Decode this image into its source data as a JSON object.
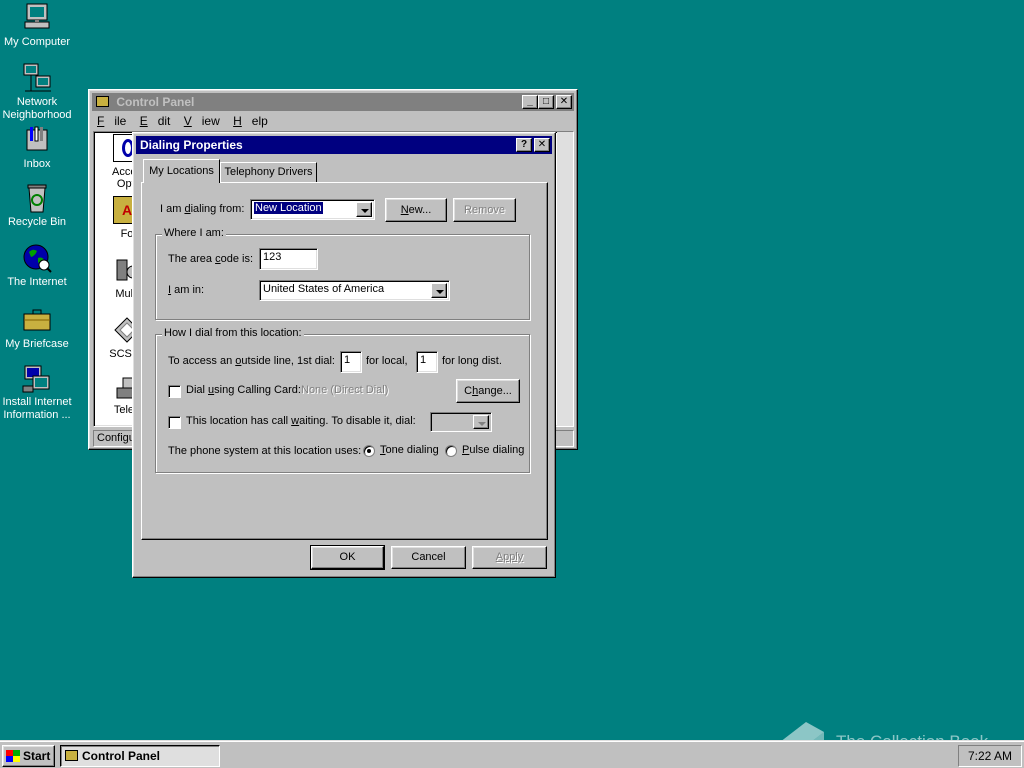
{
  "desktop": {
    "icons": [
      {
        "label": "My Computer"
      },
      {
        "label": "Network Neighborhood"
      },
      {
        "label": "Inbox"
      },
      {
        "label": "Recycle Bin"
      },
      {
        "label": "The Internet"
      },
      {
        "label": "My Briefcase"
      },
      {
        "label": "Install Internet Information ..."
      }
    ],
    "watermark": "The Collection Book"
  },
  "control_panel": {
    "title": "Control Panel",
    "menu": [
      "File",
      "Edit",
      "View",
      "Help"
    ],
    "partial_items": [
      "Acces",
      "Opti",
      "Fo",
      "Multi",
      "SCSI A",
      "Telep"
    ],
    "status": "Configu"
  },
  "dialog": {
    "title": "Dialing Properties",
    "help_button": "?",
    "close_button": "✕",
    "tabs": [
      {
        "label": "My Locations",
        "active": true
      },
      {
        "label": "Telephony Drivers",
        "active": false
      }
    ],
    "dialing_from_label": "I am dialing from:",
    "dialing_from_value": "New Location",
    "new_button": "New...",
    "remove_button": "Remove",
    "where_group": "Where I am:",
    "area_code_label": "The area code is:",
    "area_code_value": "123",
    "country_label": "I am in:",
    "country_value": "United States of America",
    "how_group": "How I dial from this location:",
    "outside_line_label": "To access an outside line, 1st dial:",
    "local_value": "1",
    "for_local": "for local,",
    "long_value": "1",
    "for_long": "for long dist.",
    "calling_card_label": "Dial using Calling Card:",
    "calling_card_value": "None (Direct Dial)",
    "change_button": "Change...",
    "call_waiting_label": "This location has call waiting. To disable it, dial:",
    "phone_system_label": "The phone system at this location uses:",
    "tone_label": "Tone dialing",
    "pulse_label": "Pulse dialing",
    "tone_selected": true,
    "ok_button": "OK",
    "cancel_button": "Cancel",
    "apply_button": "Apply"
  },
  "taskbar": {
    "start_label": "Start",
    "tasks": [
      {
        "label": "Control Panel"
      }
    ],
    "clock": "7:22 AM"
  },
  "colors": {
    "desktop": "#008080",
    "active_title": "#000080",
    "inactive_title": "#808080",
    "face": "#c0c0c0"
  }
}
